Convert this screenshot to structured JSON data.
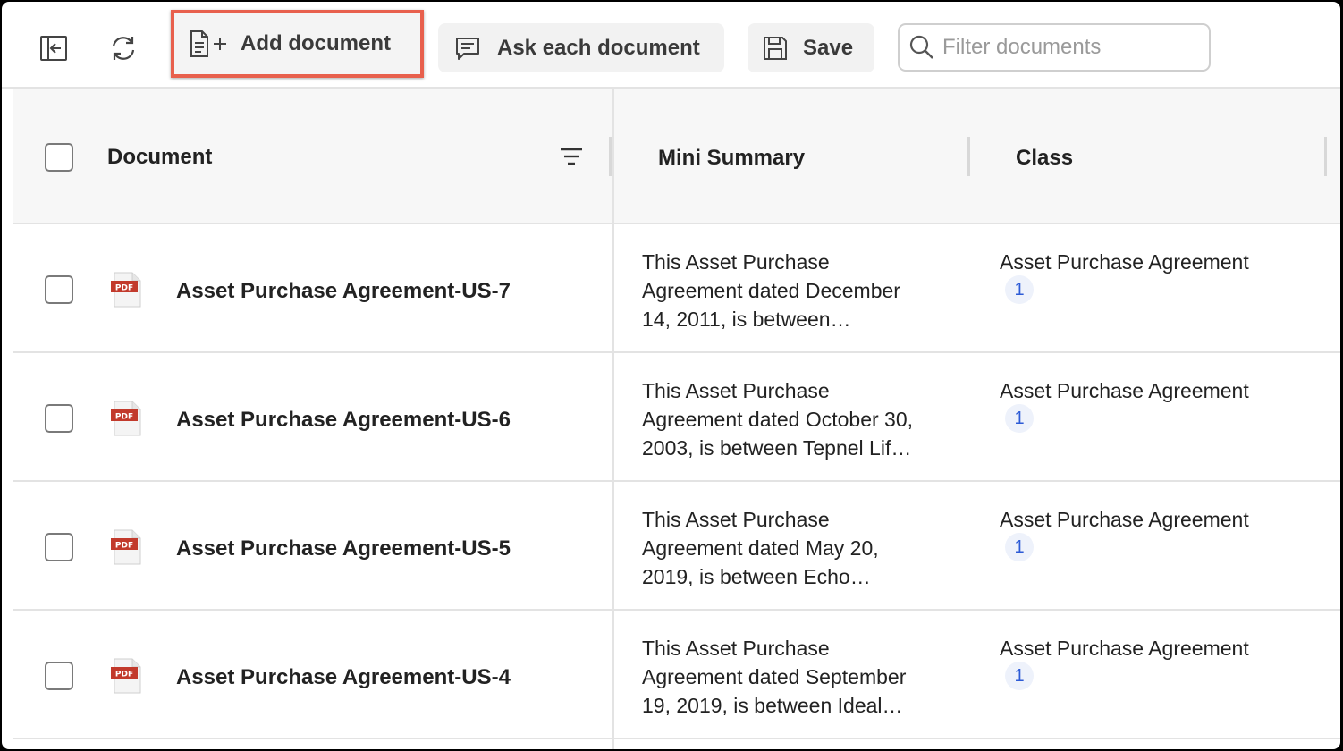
{
  "toolbar": {
    "add_label": "Add document",
    "ask_label": "Ask each document",
    "save_label": "Save",
    "filter_placeholder": "Filter documents"
  },
  "table": {
    "headers": {
      "document": "Document",
      "summary": "Mini Summary",
      "class": "Class"
    },
    "pdf_label": "PDF",
    "rows": [
      {
        "name": "Asset Purchase Agreement-US-7",
        "summary_lines": [
          "This Asset Purchase",
          "Agreement dated December",
          "14, 2011, is between…"
        ],
        "class": "Asset Purchase Agreement",
        "count": "1"
      },
      {
        "name": "Asset Purchase Agreement-US-6",
        "summary_lines": [
          "This Asset Purchase",
          "Agreement dated October 30,",
          "2003, is between Tepnel Lif…"
        ],
        "class": "Asset Purchase Agreement",
        "count": "1"
      },
      {
        "name": "Asset Purchase Agreement-US-5",
        "summary_lines": [
          "This Asset Purchase",
          "Agreement dated May 20,",
          "2019, is between Echo…"
        ],
        "class": "Asset Purchase Agreement",
        "count": "1"
      },
      {
        "name": "Asset Purchase Agreement-US-4",
        "summary_lines": [
          "This Asset Purchase",
          "Agreement dated September",
          "19, 2019, is between Ideal…"
        ],
        "class": "Asset Purchase Agreement",
        "count": "1"
      }
    ]
  },
  "colors": {
    "highlight": "#e8604d",
    "badge_text": "#2d5bd6",
    "pdf_red": "#c23a2c"
  },
  "icons": [
    "collapse-sidebar-icon",
    "refresh-icon",
    "add-document-icon",
    "chat-icon",
    "save-icon",
    "search-icon",
    "filter-icon",
    "pdf-icon"
  ]
}
